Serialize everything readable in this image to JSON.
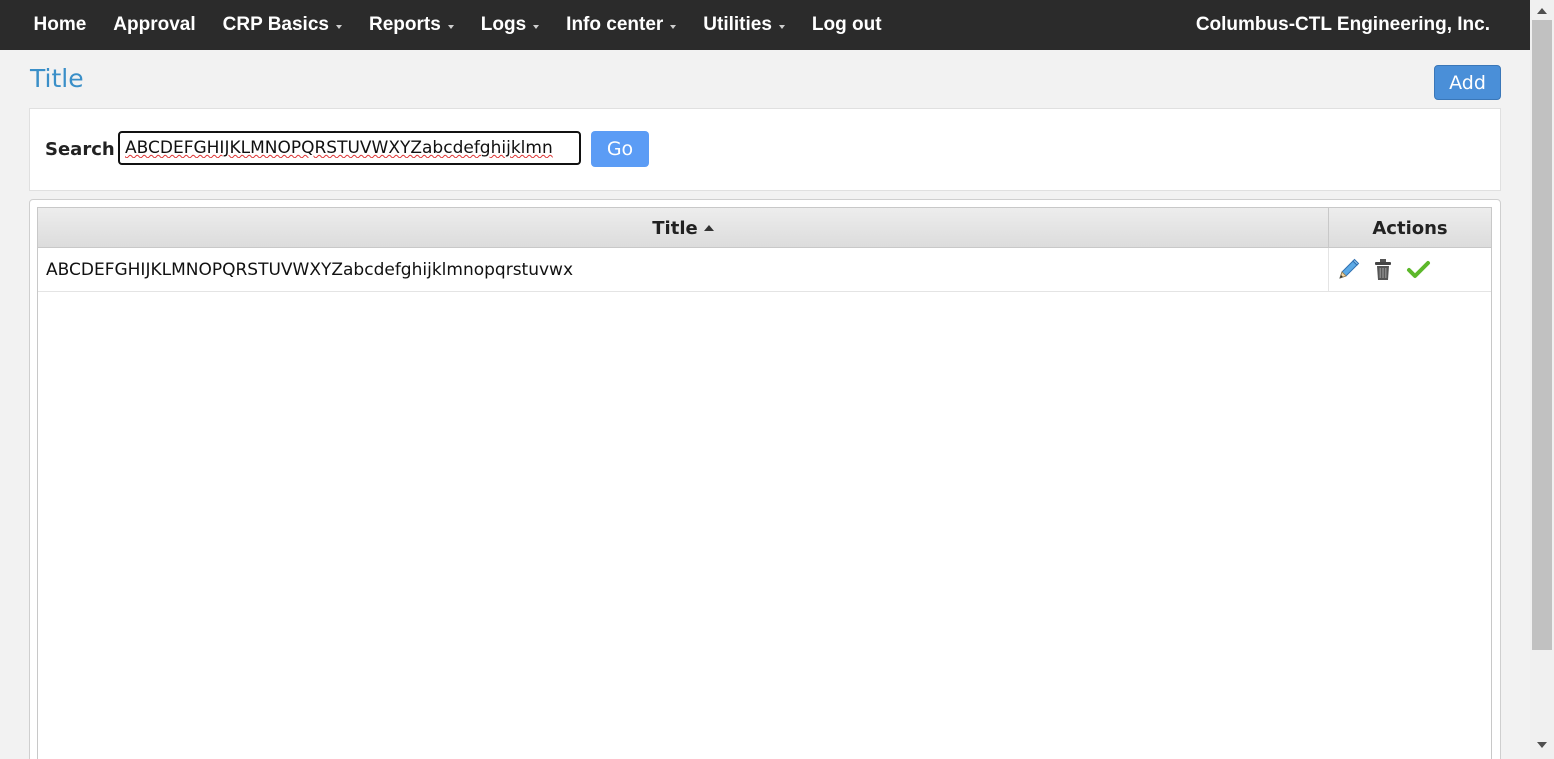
{
  "nav": {
    "items": [
      {
        "label": "Home",
        "dropdown": false
      },
      {
        "label": "Approval",
        "dropdown": false
      },
      {
        "label": "CRP Basics",
        "dropdown": true
      },
      {
        "label": "Reports",
        "dropdown": true
      },
      {
        "label": "Logs",
        "dropdown": true
      },
      {
        "label": "Info center",
        "dropdown": true
      },
      {
        "label": "Utilities",
        "dropdown": true
      },
      {
        "label": "Log out",
        "dropdown": false
      }
    ],
    "location": "Columbus",
    "separator": "-",
    "company": "CTL Engineering, Inc."
  },
  "page": {
    "title": "Title",
    "add_label": "Add"
  },
  "search": {
    "label": "Search",
    "value": "ABCDEFGHIJKLMNOPQRSTUVWXYZabcdefghijklmn",
    "go_label": "Go"
  },
  "grid": {
    "columns": {
      "title": "Title",
      "actions": "Actions"
    },
    "sort": "ascending",
    "rows": [
      {
        "title": "ABCDEFGHIJKLMNOPQRSTUVWXYZabcdefghijklmnopqrstuvwx"
      }
    ]
  },
  "icons": {
    "edit": "pencil-icon",
    "delete": "trash-icon",
    "approve": "check-icon"
  },
  "colors": {
    "navbar": "#2b2b2b",
    "title": "#3a8fc8",
    "add_button": "#4a8fd8",
    "go_button": "#5b9cf5"
  }
}
